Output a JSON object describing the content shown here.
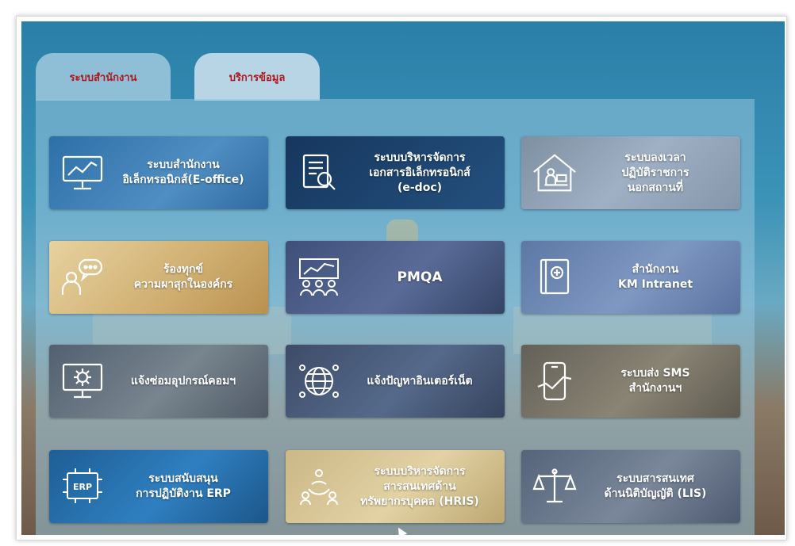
{
  "tabs": [
    {
      "label": "ระบบสำนักงาน",
      "active": true
    },
    {
      "label": "บริการข้อมูล",
      "active": false
    }
  ],
  "accent_color": "#b0151b",
  "tiles": [
    {
      "icon": "analytics-monitor-icon",
      "lines": [
        "ระบบสำนักงาน",
        "อิเล็กทรอนิกส์(E-office)"
      ]
    },
    {
      "icon": "document-search-icon",
      "lines": [
        "ระบบบริหารจัดการ",
        "เอกสารอิเล็กทรอนิกส์",
        "(e-doc)"
      ]
    },
    {
      "icon": "home-office-icon",
      "lines": [
        "ระบบลงเวลา",
        "ปฏิบัติราชการ",
        "นอกสถานที่"
      ]
    },
    {
      "icon": "person-chat-icon",
      "lines": [
        "ร้องทุกข์",
        "ความผาสุกในองค์กร"
      ]
    },
    {
      "icon": "team-chart-icon",
      "lines": [
        "PMQA"
      ]
    },
    {
      "icon": "knowledge-book-icon",
      "lines": [
        "สำนักงาน",
        "KM Intranet"
      ]
    },
    {
      "icon": "computer-gear-icon",
      "lines": [
        "แจ้งซ่อมอุปกรณ์คอมฯ"
      ]
    },
    {
      "icon": "globe-network-icon",
      "lines": [
        "แจ้งปัญหาอินเตอร์เน็ต"
      ]
    },
    {
      "icon": "phone-message-icon",
      "lines": [
        "ระบบส่ง SMS",
        "สำนักงานฯ"
      ]
    },
    {
      "icon": "erp-board-icon",
      "lines": [
        "ระบบสนับสนุน",
        "การปฏิบัติงาน ERP"
      ]
    },
    {
      "icon": "people-cycle-icon",
      "lines": [
        "ระบบบริหารจัดการ",
        "สารสนเทศด้าน",
        "ทรัพยากรบุคคล (HRIS)"
      ]
    },
    {
      "icon": "scales-icon",
      "lines": [
        "ระบบสารสนเทศ",
        "ด้านนิติบัญญัติ (LIS)"
      ]
    }
  ]
}
